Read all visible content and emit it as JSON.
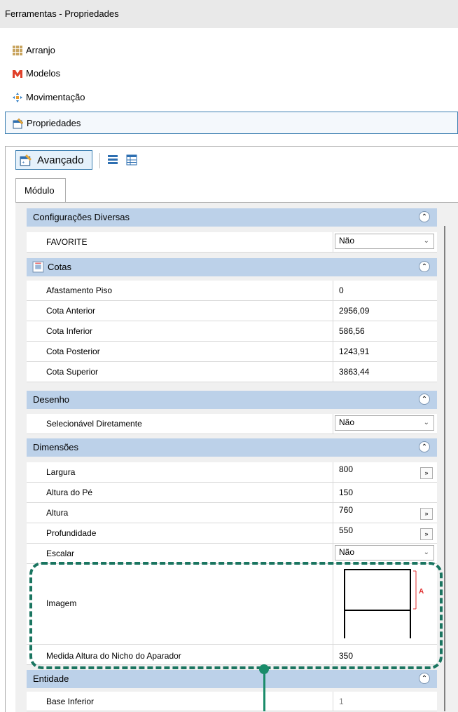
{
  "window": {
    "title": "Ferramentas - Propriedades"
  },
  "nav": [
    {
      "label": "Arranjo",
      "icon": "grid-icon"
    },
    {
      "label": "Modelos",
      "icon": "models-logo-icon"
    },
    {
      "label": "Movimentação",
      "icon": "move-arrows-icon"
    },
    {
      "label": "Propriedades",
      "icon": "properties-icon"
    }
  ],
  "toolbar": {
    "advanced_label": "Avançado"
  },
  "tab": {
    "label": "Módulo"
  },
  "sections": {
    "diversas": {
      "title": "Configurações Diversas",
      "favorite": {
        "name": "FAVORITE",
        "value": "Não"
      }
    },
    "cotas": {
      "title": "Cotas",
      "rows": [
        {
          "name": "Afastamento Piso",
          "value": "0"
        },
        {
          "name": "Cota Anterior",
          "value": "2956,09"
        },
        {
          "name": "Cota Inferior",
          "value": "586,56"
        },
        {
          "name": "Cota Posterior",
          "value": "1243,91"
        },
        {
          "name": "Cota Superior",
          "value": "3863,44"
        }
      ]
    },
    "desenho": {
      "title": "Desenho",
      "selecionavel": {
        "name": "Selecionável Diretamente",
        "value": "Não"
      }
    },
    "dimensoes": {
      "title": "Dimensões",
      "largura": {
        "name": "Largura",
        "value": "800"
      },
      "altura_pe": {
        "name": "Altura do Pé",
        "value": "150"
      },
      "altura": {
        "name": "Altura",
        "value": "760"
      },
      "profundidade": {
        "name": "Profundidade",
        "value": "550"
      },
      "escalar": {
        "name": "Escalar",
        "value": "Não"
      },
      "imagem": {
        "name": "Imagem",
        "marker": "A"
      },
      "medida_nicho": {
        "name": "Medida Altura do Nicho do Aparador",
        "value": "350"
      }
    },
    "entidade": {
      "title": "Entidade",
      "base_inferior": {
        "name": "Base Inferior",
        "value": "1"
      }
    }
  },
  "colors": {
    "category_bg": "#bcd1e9",
    "highlight": "#1a7560",
    "selected_border": "#3c7fb1",
    "marker_red": "#e03030"
  }
}
